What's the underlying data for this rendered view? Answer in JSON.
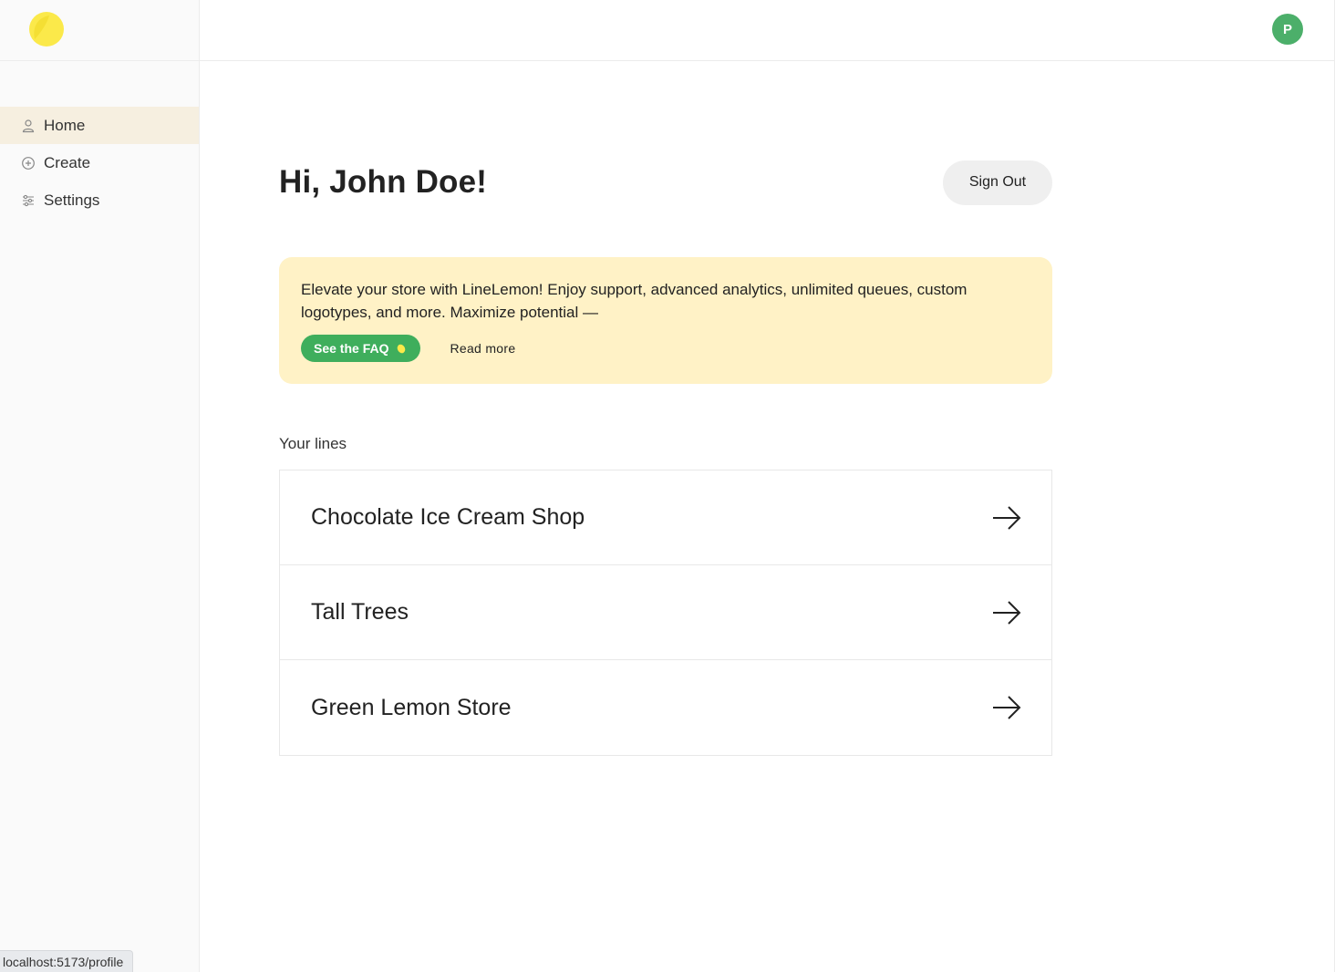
{
  "sidebar": {
    "items": [
      {
        "label": "Home",
        "icon": "user-icon",
        "active": true
      },
      {
        "label": "Create",
        "icon": "plus-circle-icon",
        "active": false
      },
      {
        "label": "Settings",
        "icon": "sliders-icon",
        "active": false
      }
    ]
  },
  "header": {
    "avatar_initial": "P"
  },
  "main": {
    "greeting": "Hi, John Doe!",
    "sign_out_label": "Sign Out",
    "promo": {
      "text": "Elevate your store with LineLemon! Enjoy support, advanced analytics, unlimited queues, custom logotypes, and more. Maximize potential —",
      "faq_label": "See the FAQ",
      "read_more_label": "Read more"
    },
    "lines_title": "Your lines",
    "lines": [
      {
        "name": "Chocolate Ice Cream Shop"
      },
      {
        "name": "Tall Trees"
      },
      {
        "name": "Green Lemon Store"
      }
    ]
  },
  "statusbar": {
    "url": "localhost:5173/profile"
  },
  "colors": {
    "accent_green": "#3fae5c",
    "promo_bg": "#fff2c6",
    "active_nav_bg": "#f6efe0",
    "logo_yellow": "#fbe94a"
  }
}
